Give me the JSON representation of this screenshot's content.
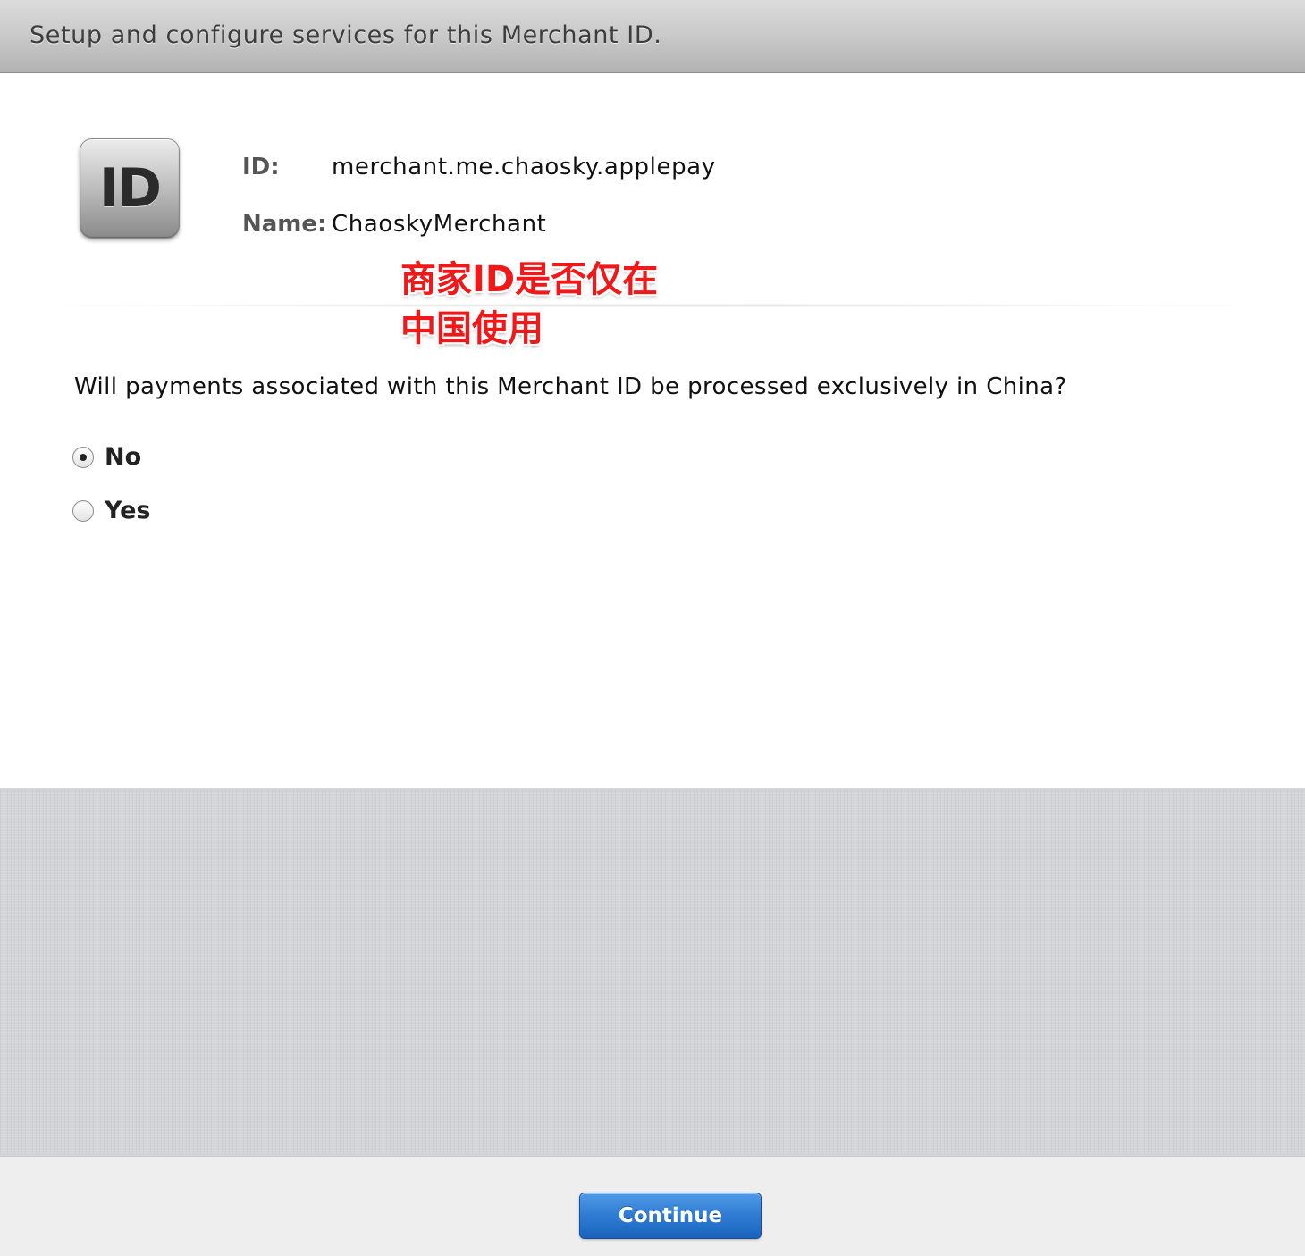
{
  "header": {
    "title": "Setup and configure services for this Merchant ID."
  },
  "icon": {
    "name": "id-icon",
    "text": "ID"
  },
  "merchant": {
    "id_label": "ID:",
    "id_value": "merchant.me.chaosky.applepay",
    "name_label": "Name:",
    "name_value": "ChaoskyMerchant"
  },
  "annotation": {
    "line1": "商家ID是否仅在",
    "line2": "中国使用",
    "color": "#f01818"
  },
  "question": {
    "text": "Will payments associated with this Merchant ID be processed exclusively in China?",
    "options": [
      {
        "label": "No",
        "selected": true
      },
      {
        "label": "Yes",
        "selected": false
      }
    ]
  },
  "footer": {
    "continue_label": "Continue",
    "button_color": "#2f7bd3"
  }
}
